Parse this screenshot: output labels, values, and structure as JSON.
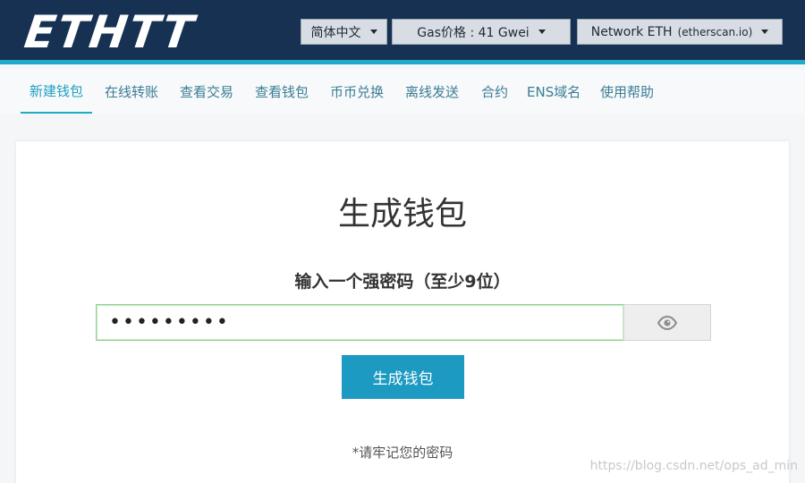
{
  "header": {
    "logo_text": "ETHTT",
    "language": {
      "selected": "简体中文"
    },
    "gas": {
      "selected": "Gas价格 : 41 Gwei"
    },
    "network": {
      "name": "Network ETH",
      "provider": "(etherscan.io)"
    }
  },
  "nav": {
    "items": [
      {
        "label": "新建钱包",
        "active": true
      },
      {
        "label": "在线转账"
      },
      {
        "label": "查看交易"
      },
      {
        "label": "查看钱包"
      },
      {
        "label": "币币兑换"
      },
      {
        "label": "离线发送"
      },
      {
        "label": "合约"
      },
      {
        "label": "ENS域名"
      },
      {
        "label": "使用帮助"
      }
    ]
  },
  "main": {
    "title": "生成钱包",
    "password_label": "输入一个强密码（至少9位）",
    "password_value": "123456789",
    "generate_button": "生成钱包",
    "remember_note": "*请牢记您的密码"
  },
  "watermark": "https://blog.csdn.net/ops_ad_min",
  "icons": {
    "eye": "eye-icon",
    "dropdown": "caret-down-icon"
  },
  "colors": {
    "header_bg": "#163152",
    "accent": "#20a9c9",
    "button": "#1c9ac2",
    "nav_text": "#3b7d95",
    "input_focus_border": "#8fd08f"
  }
}
